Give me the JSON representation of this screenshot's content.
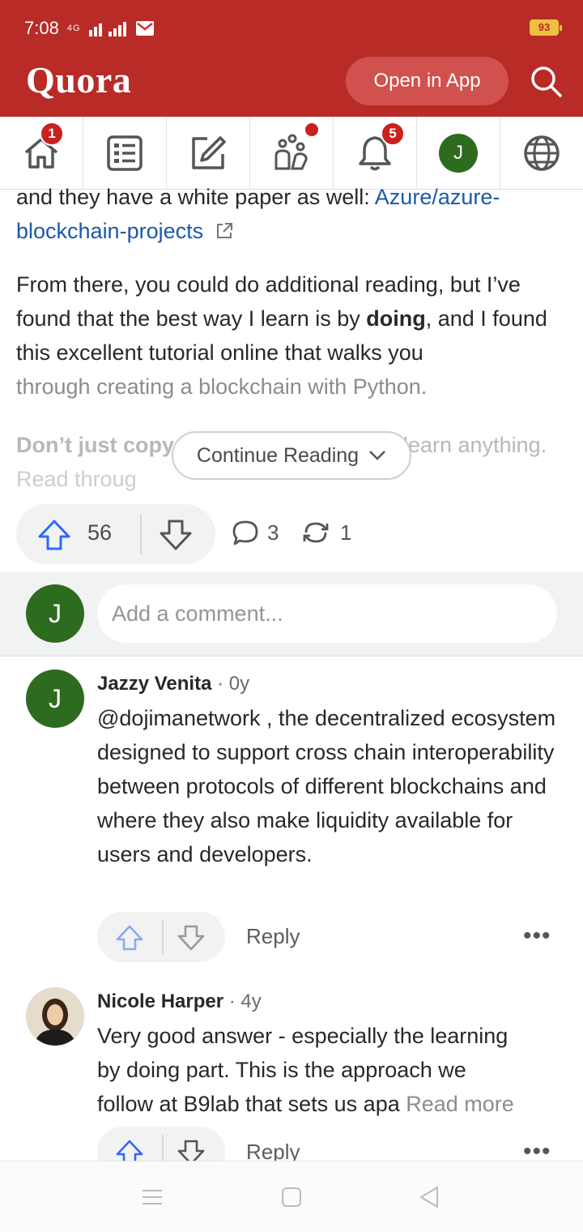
{
  "status_bar": {
    "time": "7:08",
    "signal": "4G",
    "battery": "93"
  },
  "header": {
    "logo": "Quora",
    "open_app_label": "Open in App",
    "accent_color": "#b92b27"
  },
  "nav": {
    "home_badge": "1",
    "notifications_badge": "5",
    "profile_initial": "J"
  },
  "answer": {
    "link_prefix": "and they have a white paper as well: ",
    "link_text_1": "Azure/azure-",
    "link_text_2": "blockchain-projects",
    "para2_a": "From there, you could do additional reading, but I’ve found that the best way I learn is by ",
    "para2_bold": "doing",
    "para2_b": ", and I found this excellent tutorial online that walks you",
    "para2_c": "through creating a blockchain with Python.",
    "para3_a": "Don’t just copy",
    "para3_b": "learn anything.",
    "para3_c": "Read throug",
    "continue_reading_label": "Continue Reading"
  },
  "stats": {
    "upvotes": "56",
    "comments": "3",
    "shares": "1"
  },
  "add_comment": {
    "avatar_initial": "J",
    "placeholder": "Add a comment..."
  },
  "comments": [
    {
      "avatar_initial": "J",
      "author": "Jazzy Venita",
      "time": " · 0y",
      "body": "@dojimanetwork , the decentralized ecosystem designed to support cross chain interoperability between protocols of different blockchains and where they also make liquidity available for users and developers.",
      "reply_label": "Reply",
      "more_label": "•••"
    },
    {
      "author": "Nicole Harper",
      "time": " · 4y",
      "body_line1": "Very good answer - especially the learning",
      "body_line2": "by doing part. This is the approach we",
      "body_line3": "follow at B9lab that sets us apa",
      "read_more": "Read more",
      "reply_label": "Reply",
      "more_label": "•••"
    }
  ]
}
